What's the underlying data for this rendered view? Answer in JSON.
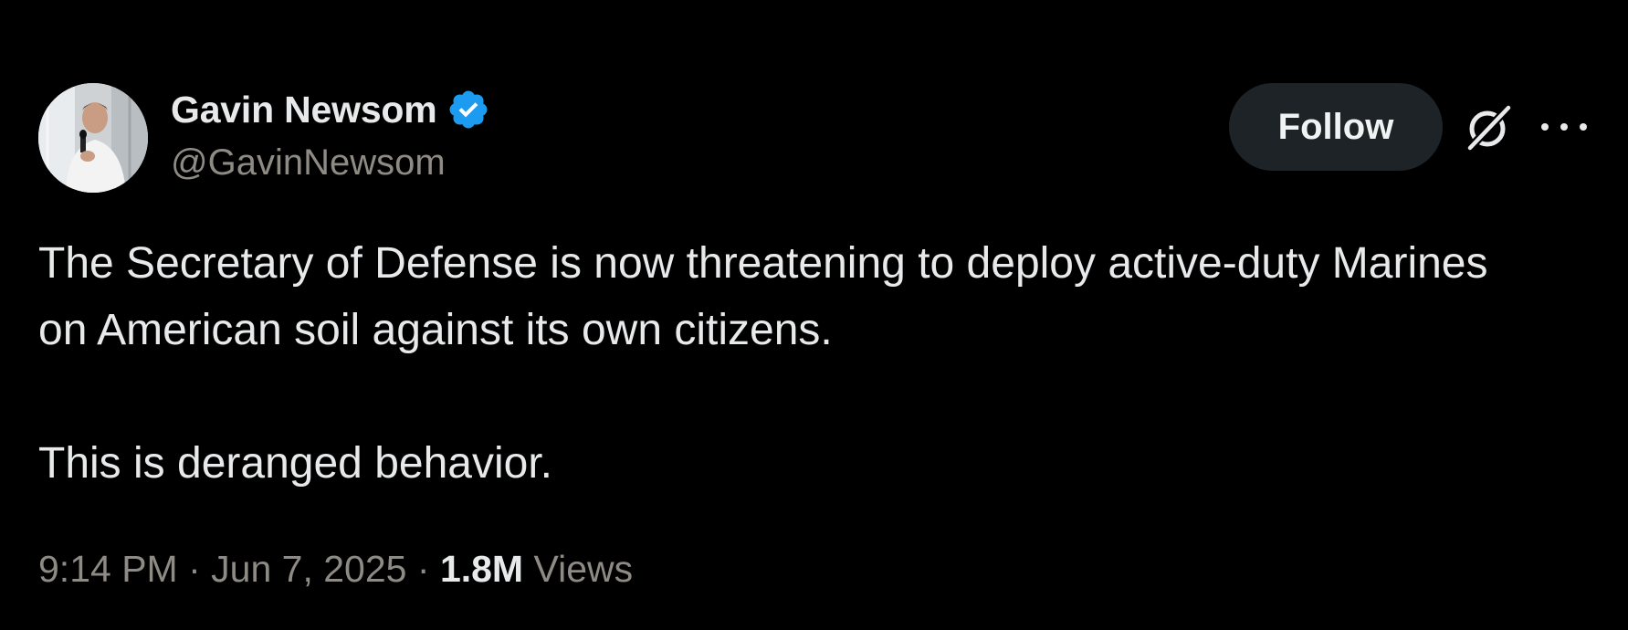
{
  "author": {
    "display_name": "Gavin Newsom",
    "handle": "@GavinNewsom",
    "verified": true,
    "avatar_icon": "profile-photo"
  },
  "actions": {
    "follow_label": "Follow",
    "grok_icon": "grok-icon",
    "more_icon": "more-horizontal-icon"
  },
  "tweet": {
    "text_line1": "The Secretary of Defense is now threatening to deploy active-duty Marines on American soil against its own citizens.",
    "text_line2": "This is deranged behavior."
  },
  "meta": {
    "time": "9:14 PM",
    "separator": "·",
    "date": "Jun 7, 2025",
    "views_count": "1.8M",
    "views_label": "Views"
  },
  "colors": {
    "background": "#000000",
    "text": "#e7e9ea",
    "secondary_text": "#8e8a84",
    "verified_badge": "#1d9bf0",
    "follow_button_bg": "#1d2326"
  }
}
